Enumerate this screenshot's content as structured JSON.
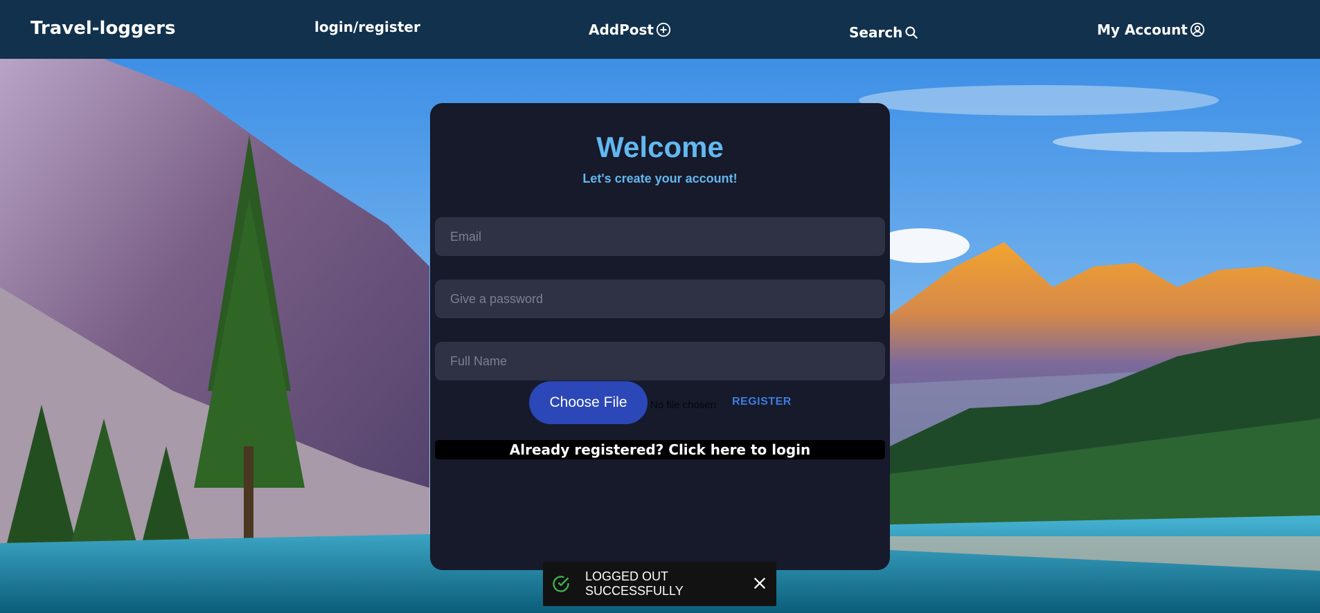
{
  "navbar": {
    "brand": "Travel-loggers",
    "login_register": "login/register",
    "add_post": "AddPost",
    "search": "Search",
    "my_account": "My Account"
  },
  "form": {
    "title": "Welcome",
    "subtitle": "Let's create your account!",
    "email_placeholder": "Email",
    "password_placeholder": "Give a password",
    "fullname_placeholder": "Full Name",
    "file_button": "Choose File",
    "file_status": "No file chosen",
    "register": "REGISTER",
    "login_link": "Already registered? Click here to login"
  },
  "toast": {
    "line1": "LOGGED OUT",
    "line2": "SUCCESSFULLY"
  },
  "colors": {
    "navbar": "#12314c",
    "card": "#161a2b",
    "accent": "#63b8ef",
    "file_button": "#2b47b8",
    "register": "#3f7ce0",
    "toast_check": "#3fb34f"
  },
  "icons": {
    "add_post": "plus-circle-icon",
    "search": "search-icon",
    "my_account": "user-circle-icon",
    "toast_status": "check-circle-icon",
    "toast_close": "close-icon"
  }
}
